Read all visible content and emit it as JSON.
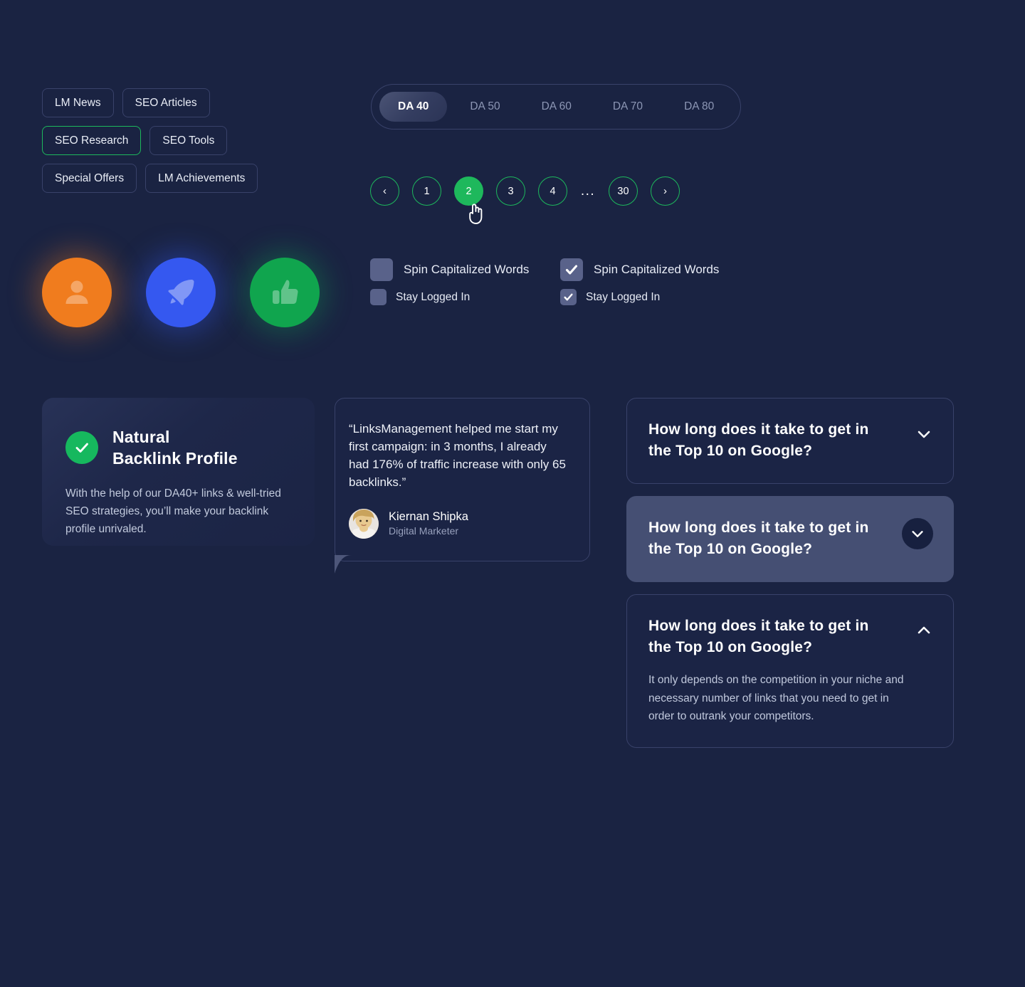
{
  "tags": [
    {
      "label": "LM News",
      "active": false
    },
    {
      "label": "SEO Articles",
      "active": false
    },
    {
      "label": "SEO Research",
      "active": true
    },
    {
      "label": "SEO Tools",
      "active": false
    },
    {
      "label": "Special Offers",
      "active": false
    },
    {
      "label": "LM Achievements",
      "active": false
    }
  ],
  "da_tabs": {
    "items": [
      {
        "label": "DA 40",
        "active": true
      },
      {
        "label": "DA 50",
        "active": false
      },
      {
        "label": "DA 60",
        "active": false
      },
      {
        "label": "DA 70",
        "active": false
      },
      {
        "label": "DA 80",
        "active": false
      }
    ]
  },
  "pagination": {
    "prev_label": "‹",
    "next_label": "›",
    "pages": [
      "1",
      "2",
      "3",
      "4"
    ],
    "ellipsis": "...",
    "last_page": "30",
    "current_page": "2"
  },
  "icon_circles": [
    {
      "name": "person-icon",
      "color": "#f07c1e"
    },
    {
      "name": "rocket-icon",
      "color": "#3558f0"
    },
    {
      "name": "thumbs-up-icon",
      "color": "#10a54e"
    }
  ],
  "checkboxes": {
    "left": [
      {
        "label": "Spin Capitalized Words",
        "checked": false,
        "size": "big"
      },
      {
        "label": "Stay Logged In",
        "checked": false,
        "size": "small"
      }
    ],
    "right": [
      {
        "label": "Spin Capitalized Words",
        "checked": true,
        "size": "big"
      },
      {
        "label": "Stay Logged In",
        "checked": true,
        "size": "small"
      }
    ]
  },
  "natural_backlink": {
    "title_line1": "Natural",
    "title_line2": "Backlink Profile",
    "description": "With the help of our DA40+ links & well-tried SEO strategies, you’ll make your backlink profile unrivaled."
  },
  "testimonial": {
    "quote": "“LinksManagement helped me start my first campaign: in 3 months, I already had 176% of traffic increase with only 65 backlinks.”",
    "name": "Kiernan Shipka",
    "role": "Digital Marketer"
  },
  "faq": {
    "items": [
      {
        "question": "How long does it take to get in the Top 10 on Google?",
        "answer": "",
        "state": "collapsed",
        "chevron": "chevron-down-icon"
      },
      {
        "question": "How long does it take to get in the Top 10 on Google?",
        "answer": "",
        "state": "hover",
        "chevron": "chevron-down-icon"
      },
      {
        "question": "How long does it take to get in the Top 10 on Google?",
        "answer": "It only depends on the competition in your niche and necessary number of links that you need to get in order to outrank your competitors.",
        "state": "expanded",
        "chevron": "chevron-up-icon"
      }
    ]
  },
  "colors": {
    "background": "#1a2342",
    "card": "#1b2445",
    "border": "#39426a",
    "accent_green": "#1eb85c",
    "hover_slate": "#454f73",
    "checkbox": "#59628a",
    "text_primary": "#ffffff",
    "text_muted": "#c0c8dc"
  }
}
